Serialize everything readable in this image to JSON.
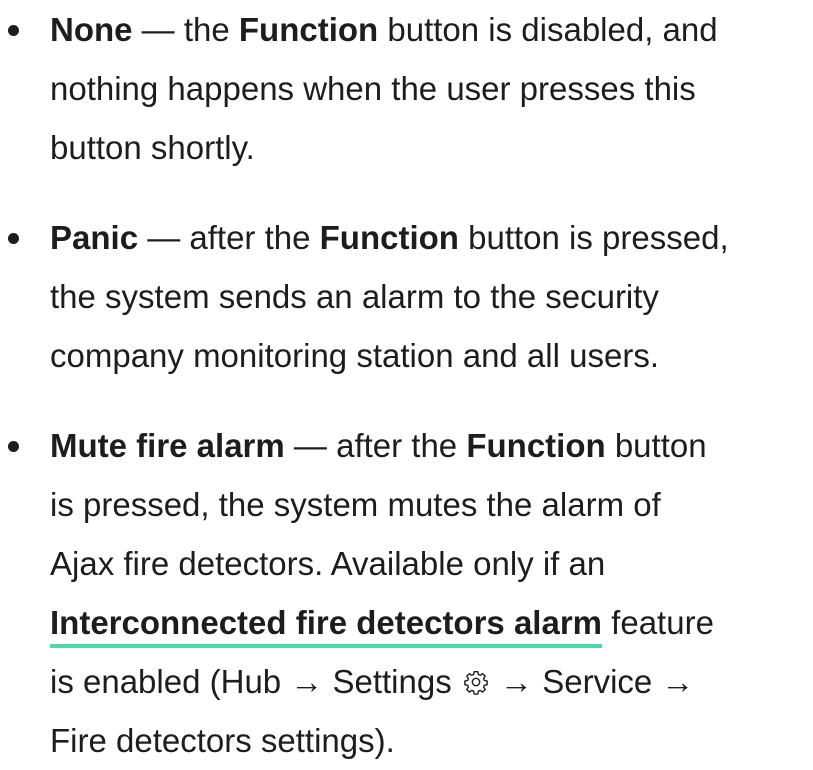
{
  "items": [
    {
      "lines": [
        {
          "bold": "None",
          "t1": " — the ",
          "b2": "Function",
          "t2": " button is disabled, and"
        },
        {
          "text": "nothing happens when the user presses this"
        },
        {
          "text": "button shortly."
        }
      ]
    },
    {
      "lines": [
        {
          "bold": "Panic",
          "t1": " — after the ",
          "b2": "Function",
          "t2": " button is pressed,"
        },
        {
          "text": "the system sends an alarm to the security"
        },
        {
          "text": "company monitoring station and all users."
        }
      ]
    },
    {
      "lines": [
        {
          "bold": "Mute fire alarm",
          "t1": " — after the ",
          "b2": "Function",
          "t2": " button"
        },
        {
          "text": "is pressed, the system mutes the alarm of"
        },
        {
          "text": "Ajax fire detectors. Available only if an"
        },
        {
          "link": "Interconnected fire detectors alarm",
          "after": " feature"
        },
        {
          "before": "is enabled (Hub → Settings ",
          "after": " → Service →"
        },
        {
          "text": "Fire detectors settings)."
        }
      ]
    }
  ],
  "icons": {
    "settings": "gear-icon"
  },
  "colors": {
    "text": "#1d1d1d",
    "link_underline": "#4fd7a7"
  }
}
